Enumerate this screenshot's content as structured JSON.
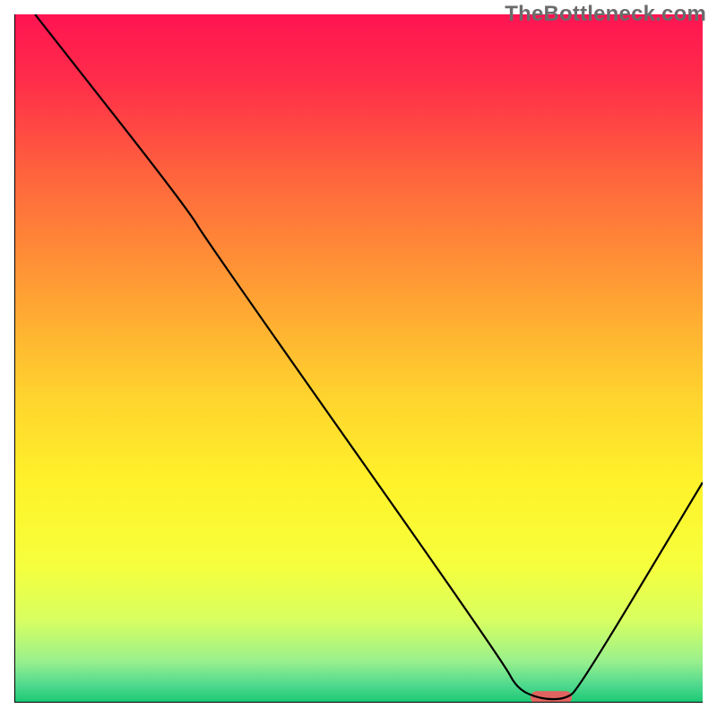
{
  "watermark": "TheBottleneck.com",
  "chart_data": {
    "type": "line",
    "title": "",
    "xlabel": "",
    "ylabel": "",
    "xlim": [
      0,
      100
    ],
    "ylim": [
      0,
      100
    ],
    "background_gradient": [
      {
        "offset": 0.0,
        "color": "#ff1452"
      },
      {
        "offset": 0.1,
        "color": "#ff2e49"
      },
      {
        "offset": 0.25,
        "color": "#ff6a3c"
      },
      {
        "offset": 0.4,
        "color": "#ff9e34"
      },
      {
        "offset": 0.55,
        "color": "#ffd22e"
      },
      {
        "offset": 0.68,
        "color": "#fff22a"
      },
      {
        "offset": 0.8,
        "color": "#f6ff3c"
      },
      {
        "offset": 0.88,
        "color": "#d8ff60"
      },
      {
        "offset": 0.94,
        "color": "#99f08d"
      },
      {
        "offset": 0.975,
        "color": "#4ed98e"
      },
      {
        "offset": 1.0,
        "color": "#19c873"
      }
    ],
    "series": [
      {
        "name": "bottleneck-curve",
        "points": [
          {
            "x": 3,
            "y": 100
          },
          {
            "x": 25,
            "y": 72
          },
          {
            "x": 28,
            "y": 67
          },
          {
            "x": 71,
            "y": 6
          },
          {
            "x": 73,
            "y": 2
          },
          {
            "x": 76.5,
            "y": 0.5
          },
          {
            "x": 80,
            "y": 0.5
          },
          {
            "x": 82,
            "y": 2
          },
          {
            "x": 100,
            "y": 32
          }
        ]
      }
    ],
    "marker": {
      "x_center": 78,
      "y": 0.9,
      "width": 6,
      "color": "#e0635f"
    },
    "axes": {
      "stroke": "#000000",
      "stroke_width": 2
    }
  }
}
